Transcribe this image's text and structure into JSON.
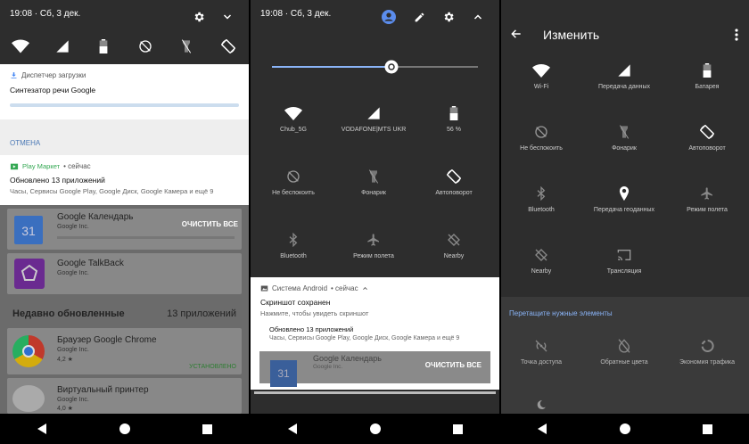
{
  "panel1": {
    "status_time": "19:08 · Сб, 3 дек.",
    "download_source": "Диспетчер загрузки",
    "download_title": "Синтезатор речи Google",
    "cancel_label": "ОТМЕНА",
    "market_source": "Play Маркет",
    "market_when": "• сейчас",
    "market_title": "Обновлено 13 приложений",
    "market_text": "Часы, Сервисы Google Play, Google Диск, Google Камера и ещё 9",
    "apps": [
      {
        "name": "Google Календарь",
        "publisher": "Google Inc.",
        "icon_text": "31"
      },
      {
        "name": "Google TalkBack",
        "publisher": "Google Inc."
      }
    ],
    "clear_all": "ОЧИСТИТЬ ВСЕ",
    "recent_heading": "Недавно обновленные",
    "recent_count": "13 приложений",
    "recent_apps": [
      {
        "name": "Браузер Google Chrome",
        "publisher": "Google Inc.",
        "rating": "4,2 ★",
        "status": "УСТАНОВЛЕНО"
      },
      {
        "name": "Виртуальный принтер",
        "publisher": "Google Inc.",
        "rating": "4,0 ★"
      }
    ]
  },
  "panel2": {
    "status_time": "19:08 · Сб, 3 дек.",
    "brightness_level": 0.58,
    "tiles": [
      {
        "label": "Chub_5G",
        "icon": "wifi-icon"
      },
      {
        "label": "VODAFONE|MTS UKR",
        "icon": "signal-icon"
      },
      {
        "label": "56 %",
        "icon": "battery-icon"
      },
      {
        "label": "Не беспокоить",
        "icon": "dnd-icon"
      },
      {
        "label": "Фонарик",
        "icon": "flashlight-icon"
      },
      {
        "label": "Автоповорот",
        "icon": "autorotate-icon"
      },
      {
        "label": "Bluetooth",
        "icon": "bluetooth-icon"
      },
      {
        "label": "Режим полета",
        "icon": "airplane-icon"
      },
      {
        "label": "Nearby",
        "icon": "nearby-icon"
      }
    ],
    "notif_source": "Система Android",
    "notif_when": "• сейчас",
    "notif_title": "Скриншот сохранен",
    "notif_text": "Нажмите, чтобы увидеть скриншот",
    "sub_title": "Обновлено 13 приложений",
    "sub_text": "Часы, Сервисы Google Play, Google Диск, Google Камера и ещё 9",
    "app_name": "Google Календарь",
    "app_pub": "Google Inc.",
    "app_icon_text": "31",
    "clear_all": "ОЧИСТИТЬ ВСЕ"
  },
  "panel3": {
    "title": "Изменить",
    "tiles": [
      {
        "label": "Wi-Fi",
        "icon": "wifi-icon"
      },
      {
        "label": "Передача данных",
        "icon": "signal-icon"
      },
      {
        "label": "Батарея",
        "icon": "battery-icon"
      },
      {
        "label": "Не беспокоить",
        "icon": "dnd-icon"
      },
      {
        "label": "Фонарик",
        "icon": "flashlight-icon"
      },
      {
        "label": "Автоповорот",
        "icon": "autorotate-icon"
      },
      {
        "label": "Bluetooth",
        "icon": "bluetooth-icon"
      },
      {
        "label": "Передача геоданных",
        "icon": "location-icon"
      },
      {
        "label": "Режим полета",
        "icon": "airplane-icon"
      },
      {
        "label": "Nearby",
        "icon": "nearby-icon"
      },
      {
        "label": "Трансляция",
        "icon": "cast-icon"
      }
    ],
    "drag_hint": "Перетащите нужные элементы",
    "extra_tiles": [
      {
        "label": "Точка доступа",
        "icon": "hotspot-icon"
      },
      {
        "label": "Обратные цвета",
        "icon": "invert-colors-icon"
      },
      {
        "label": "Экономия трафика",
        "icon": "data-saver-icon"
      }
    ],
    "accent": "#8ab4f8"
  }
}
